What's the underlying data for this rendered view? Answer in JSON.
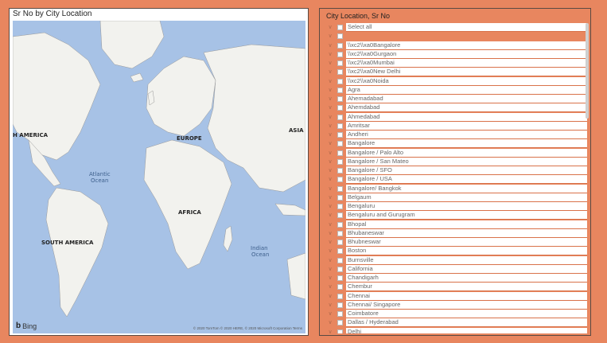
{
  "map": {
    "title": "Sr No by City Location",
    "labels": {
      "north_america": "H AMERICA",
      "europe": "EUROPE",
      "asia": "ASIA",
      "africa": "AFRICA",
      "south_america": "SOUTH AMERICA",
      "atlantic_1": "Atlantic",
      "atlantic_2": "Ocean",
      "indian_1": "Indian",
      "indian_2": "Ocean"
    },
    "logo": "Bing",
    "attribution": "© 2020 TomTom © 2020 HERE, © 2020 Microsoft Corporation  Terms"
  },
  "slicer": {
    "header": "City Location, Sr No",
    "items": [
      "Select all",
      "",
      "\\\\xc2\\\\xa0Bangalore",
      "\\\\xc2\\\\xa0Gurgaon",
      "\\\\xc2\\\\xa0Mumbai",
      "\\\\xc2\\\\xa0New Delhi",
      "\\\\xc2\\\\xa0Noida",
      "Agra",
      "Ahemadabad",
      "Ahemdabad",
      "Ahmedabad",
      "Amritsar",
      "Andheri",
      "Bangalore",
      "Bangalore / Palo Alto",
      "Bangalore / San Mateo",
      "Bangalore / SFO",
      "Bangalore / USA",
      "Bangalore/ Bangkok",
      "Belgaum",
      "Bengaluru",
      "Bengaluru and Gurugram",
      "Bhopal",
      "Bhubaneswar",
      "Bhubneswar",
      "Boston",
      "Burnsville",
      "California",
      "Chandigarh",
      "Chembur",
      "Chennai",
      "Chennai/ Singapore",
      "Coimbatore",
      "Dallas / Hyderabad",
      "Delhi"
    ]
  },
  "colors": {
    "background": "#e8865f",
    "ocean": "#a7c2e6",
    "land": "#f2f2ee",
    "row_border": "#d9724a"
  }
}
